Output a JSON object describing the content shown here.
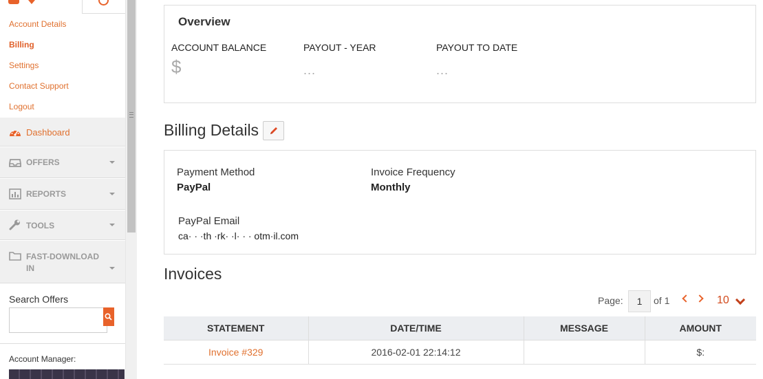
{
  "account_menu": {
    "items": [
      "Account Details",
      "Billing",
      "Settings",
      "Contact Support",
      "Logout"
    ]
  },
  "nav": {
    "dashboard": "Dashboard",
    "offers": "OFFERS",
    "reports": "REPORTS",
    "tools": "TOOLS",
    "fast_download_line1": "FAST-DOWNLOAD",
    "fast_download_line2": "IN"
  },
  "search": {
    "title": "Search Offers",
    "value": ""
  },
  "account_manager": {
    "label": "Account Manager:"
  },
  "overview": {
    "title": "Overview",
    "account_balance_label": "ACCOUNT BALANCE",
    "account_balance_value": "$",
    "payout_year_label": "PAYOUT - YEAR",
    "payout_year_value": "...",
    "payout_to_date_label": "PAYOUT TO DATE",
    "payout_to_date_value": "..."
  },
  "billing_details": {
    "title": "Billing Details",
    "payment_method_label": "Payment Method",
    "payment_method_value": "PayPal",
    "invoice_frequency_label": "Invoice Frequency",
    "invoice_frequency_value": "Monthly",
    "paypal_email_label": "PayPal Email",
    "paypal_email_value": "ca·  · ·th  ·rk· ·l·  ·  ·      otm·il.com"
  },
  "invoices": {
    "title": "Invoices",
    "pager": {
      "page_label": "Page:",
      "current_page": "1",
      "of_label": "of 1",
      "per_page": "10"
    },
    "columns": [
      "STATEMENT",
      "DATE/TIME",
      "MESSAGE",
      "AMOUNT"
    ],
    "rows": [
      {
        "statement": "Invoice #329",
        "datetime": "2016-02-01 22:14:12",
        "message": "",
        "amount": "$:"
      }
    ]
  },
  "colors": {
    "accent": "#e8622a",
    "header_bg": "#eceef1",
    "sidebar_bg": "#f0f0f0"
  }
}
